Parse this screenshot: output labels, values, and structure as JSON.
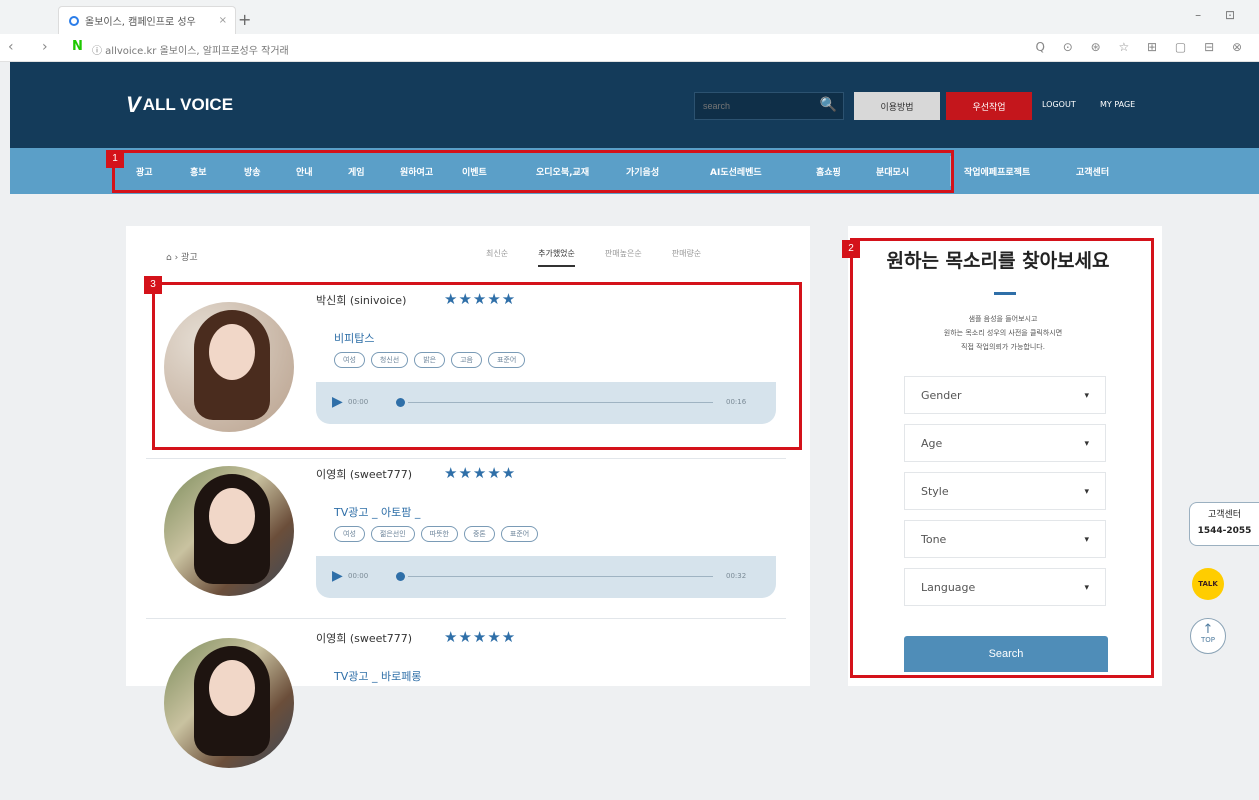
{
  "browser": {
    "tab_title": "올보이스, 캠페인프로 성우",
    "tab_close": "×",
    "new_tab": "+",
    "window_controls": "– ⊡",
    "nav_buttons": "‹ ›",
    "naver": "N",
    "url": "ⓘ allvoice.kr  올보이스, 알피프로성우 작거래",
    "toolbar_icons": "Q ⊙ ⊛ ☆ ⊞ ▢ ⊟ ⊗"
  },
  "header": {
    "logo_mark": "V",
    "logo_text": "ALL VOICE",
    "search_placeholder": "search",
    "search_icon": "🔍",
    "guide_button": "이용방법",
    "request_button": "우선작업",
    "logout": "LOGOUT",
    "mypage": "MY PAGE"
  },
  "nav": {
    "items": [
      "광고",
      "홍보",
      "방송",
      "안내",
      "게임",
      "원하여고",
      "이벤트",
      "오디오북,교재",
      "가기음성",
      "AI도선레벤드",
      "홈쇼핑",
      "분대모시",
      "작업에페프로젝트",
      "고객센터"
    ]
  },
  "annotations": [
    "1",
    "2",
    "3"
  ],
  "content": {
    "home_icon": "⌂",
    "breadcrumb": "› 광고",
    "tabs": [
      "최신순",
      "추가했었순",
      "판매높은순",
      "판매량순"
    ],
    "voices": [
      {
        "name": "박신희 (sinivoice)",
        "stars": "★★★★★",
        "title": "비피탑스",
        "tags": [
          "여성",
          "청신선",
          "밝은",
          "고음",
          "표준어"
        ],
        "play_icon": "▶",
        "time_start": "00:00",
        "time_end": "00:16",
        "progress": 0
      },
      {
        "name": "이영희 (sweet777)",
        "stars": "★★★★★",
        "title": "TV광고 _ 아토팜 _",
        "tags": [
          "여성",
          "젊은선인",
          "따뜻한",
          "중톤",
          "표준어"
        ],
        "play_icon": "▶",
        "time_start": "00:00",
        "time_end": "00:32",
        "progress": 0
      },
      {
        "name": "이영희 (sweet777)",
        "stars": "★★★★★",
        "title": "TV광고 _ 바로페롱"
      }
    ]
  },
  "sidebar": {
    "title": "원하는 목소리를 찾아보세요",
    "desc_lines": [
      "샘플 음성을 들어보시고",
      "원하는 목소리 성우의 사전을 클릭하시면",
      "직접 작업의뢰가 가능합니다."
    ],
    "filters": [
      "Gender",
      "Age",
      "Style",
      "Tone",
      "Language"
    ],
    "caret": "▾",
    "search_button": "Search"
  },
  "floating": {
    "cs_label": "고객센터",
    "cs_phone": "1544-2055",
    "talk": "TALK",
    "top_arrow": "↑",
    "top_label": "TOP"
  },
  "colors": {
    "header_bg": "#143b5a",
    "nav_bg": "#5b9fc8",
    "accent_red": "#c4161c",
    "accent_blue": "#2f6fa8",
    "annotation_red": "#d4121a"
  }
}
